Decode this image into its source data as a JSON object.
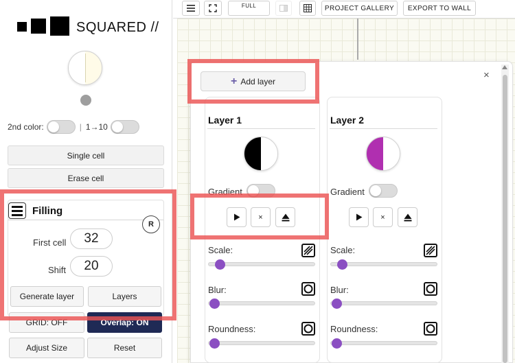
{
  "app": {
    "title": "SQUARED //"
  },
  "sidebar": {
    "second_color_label": "2nd color:",
    "range_label": "1→10",
    "single_cell_label": "Single cell",
    "erase_cell_label": "Erase cell",
    "filling": {
      "title": "Filling",
      "reset_badge": "R",
      "first_cell_label": "First cell",
      "first_cell_value": "32",
      "shift_label": "Shift",
      "shift_value": "20",
      "generate_layer_label": "Generate layer",
      "layers_label": "Layers"
    },
    "grid_label": "GRID: OFF",
    "overlap_label": "Overlap: ON",
    "adjust_size_label": "Adjust Size",
    "reset_label": "Reset"
  },
  "toolbar": {
    "full_label": "FULL",
    "project_gallery_label": "PROJECT GALLERY",
    "export_label": "EXPORT TO WALL"
  },
  "layers_panel": {
    "add_layer_label": "Add layer",
    "close_glyph": "×",
    "layers": [
      {
        "title": "Layer 1",
        "gradient_label": "Gradient",
        "scale_label": "Scale:",
        "blur_label": "Blur:",
        "roundness_label": "Roundness:",
        "left_color": "#000000",
        "right_color": "#ffffff"
      },
      {
        "title": "Layer 2",
        "gradient_label": "Gradient",
        "scale_label": "Scale:",
        "blur_label": "Blur:",
        "roundness_label": "Roundness:",
        "left_color": "#b02fb0",
        "right_color": "#ffffff"
      }
    ],
    "stop_glyph": "×"
  },
  "colors": {
    "accent_purple": "#8b4fc2",
    "dark_button": "#1f2a55",
    "highlight": "#ec5454"
  }
}
